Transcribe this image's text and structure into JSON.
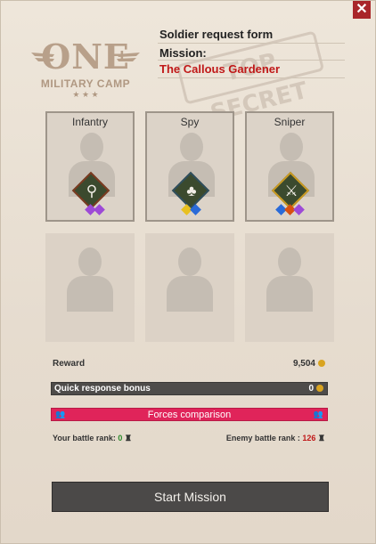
{
  "close_label": "✕",
  "logo": {
    "big": "ONE",
    "small": "MILITARY CAMP",
    "stars": "★ ★ ★"
  },
  "form": {
    "title": "Soldier request form",
    "mission_label": "Mission:",
    "mission_name": "The Callous Gardener",
    "stamp_text": "TOP SECRET"
  },
  "soldiers": [
    {
      "name": "Infantry",
      "icon": "pistol-icon",
      "glyph": "⚲",
      "badge": "red",
      "gems": [
        "#9d4ad6",
        "#9d4ad6"
      ]
    },
    {
      "name": "Spy",
      "icon": "spy-icon",
      "glyph": "♣",
      "badge": "blue",
      "gems": [
        "#e8c020",
        "#2a6ad8"
      ]
    },
    {
      "name": "Sniper",
      "icon": "rifle-icon",
      "glyph": "⚔",
      "badge": "gold",
      "gems": [
        "#2a6ad8",
        "#d85010",
        "#9d4ad6"
      ]
    }
  ],
  "reward": {
    "label": "Reward",
    "value": "9,504"
  },
  "bonus": {
    "label": "Quick response bonus",
    "value": "0"
  },
  "forces": {
    "label": "Forces comparison"
  },
  "ranks": {
    "yours_label": "Your battle rank:",
    "yours_value": "0",
    "enemy_label": "Enemy battle rank :",
    "enemy_value": "126"
  },
  "start_label": "Start Mission",
  "colors": {
    "accent_red": "#c01818",
    "forces_bar": "#e0245a",
    "button": "#4b4948"
  }
}
